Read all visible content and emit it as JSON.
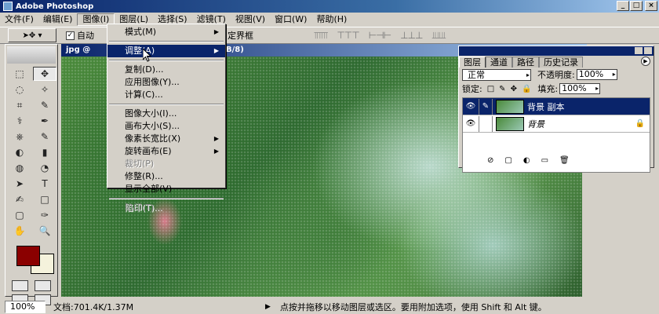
{
  "title": "Adobe Photoshop",
  "window_controls": [
    "_",
    "□",
    "×"
  ],
  "menubar": [
    "文件(F)",
    "编辑(E)",
    "图像(I)",
    "图层(L)",
    "选择(S)",
    "滤镜(T)",
    "视图(V)",
    "窗口(W)",
    "帮助(H)"
  ],
  "options_bar": {
    "auto_select": "自动",
    "checkbox_mark": "✓",
    "show_bbox": "定界框",
    "align_icons": [
      "⫪⫪⫪",
      "⊤⊤⊤",
      "⊢⊣⊢",
      "⊥⊥⊥",
      "⫫⫫⫫"
    ]
  },
  "document": {
    "title_left": "jpg @",
    "title_right": "B/8)"
  },
  "image_menu": {
    "items": [
      {
        "label": "模式(M)",
        "arrow": "▶",
        "disabled": false
      },
      {
        "sep": true
      },
      {
        "label": "调整(A)",
        "arrow": "▶",
        "highlight": true
      },
      {
        "sep": true
      },
      {
        "label": "复制(D)...",
        "arrow": ""
      },
      {
        "label": "应用图像(Y)...",
        "arrow": ""
      },
      {
        "label": "计算(C)...",
        "arrow": ""
      },
      {
        "sep": true
      },
      {
        "label": "图像大小(I)...",
        "arrow": ""
      },
      {
        "label": "画布大小(S)...",
        "arrow": ""
      },
      {
        "label": "像素长宽比(X)",
        "arrow": "▶"
      },
      {
        "label": "旋转画布(E)",
        "arrow": "▶"
      },
      {
        "label": "裁切(P)",
        "arrow": "",
        "disabled": true
      },
      {
        "label": "修整(R)...",
        "arrow": ""
      },
      {
        "label": "显示全部(V)",
        "arrow": ""
      },
      {
        "sep": true
      },
      {
        "label": "陷印(T)...",
        "arrow": "",
        "disabled": true
      }
    ]
  },
  "layers_panel": {
    "tabs": [
      "图层",
      "通道",
      "路径",
      "历史记录"
    ],
    "menu_arrow": "▶",
    "blend_mode": "正常",
    "opacity_label": "不透明度:",
    "opacity_value": "100%",
    "lock_label": "锁定:",
    "lock_icons": [
      "□",
      "✎",
      "✥",
      "🔒"
    ],
    "fill_label": "填充:",
    "fill_value": "100%",
    "layers": [
      {
        "name": "背景 副本",
        "selected": true,
        "brush": "✎",
        "lock": ""
      },
      {
        "name": "背景",
        "selected": false,
        "brush": "",
        "lock": "🔒"
      }
    ],
    "eye": "👁",
    "footer_icons": [
      "⊘",
      "▢",
      "◐",
      "▭",
      "🗑"
    ]
  },
  "toolbox": {
    "tools": [
      "⬚",
      "✥",
      "◌",
      "✧",
      "⌗",
      "✎",
      "⚕",
      "✒",
      "⎈",
      "✎",
      "◐",
      "▮",
      "◍",
      "◔",
      "➤",
      "T",
      "✍",
      "□",
      "▢",
      "✑",
      "✋",
      "🔍"
    ]
  },
  "status_bar": {
    "zoom": "100%",
    "doc": "文档:701.4K/1.37M",
    "play": "▶",
    "hint": "点按并拖移以移动图层或选区。要用附加选项，使用 Shift 和 Alt 键。"
  },
  "colors": {
    "foreground": "#8b0000",
    "background": "#f5f2dc",
    "highlight": "#0a246a"
  }
}
